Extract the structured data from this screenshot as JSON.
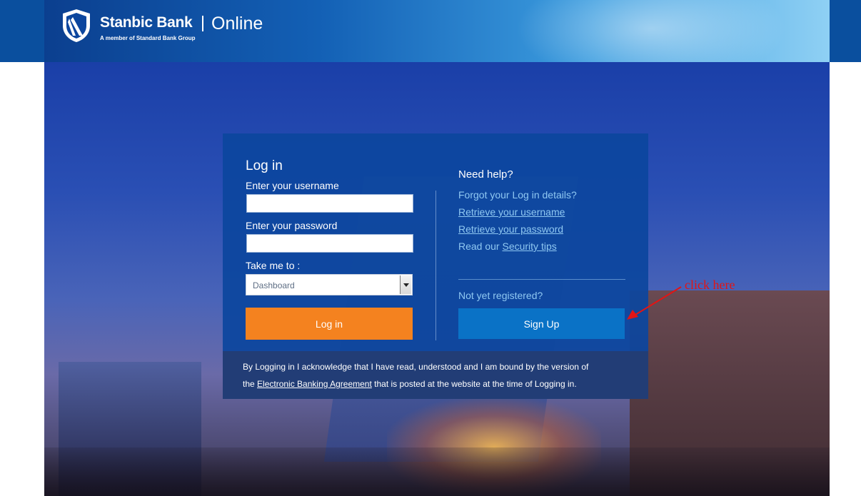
{
  "brand": {
    "name": "Stanbic Bank",
    "tagline": "A member of Standard Bank Group",
    "product": "Online",
    "colors": {
      "primary": "#0c469e",
      "accent": "#f4821f",
      "signup": "#0a72c6",
      "link": "#8fc8f2"
    }
  },
  "login": {
    "title": "Log in",
    "username_label": "Enter your username",
    "username_value": "",
    "password_label": "Enter your password",
    "password_value": "",
    "take_me_label": "Take me to :",
    "take_me_value": "Dashboard",
    "button_label": "Log in"
  },
  "help": {
    "title": "Need help?",
    "forgot_text": "Forgot your Log in details?",
    "retrieve_username": "Retrieve your username",
    "retrieve_password": "Retrieve your password",
    "security_prefix": "Read our",
    "security_link": "Security tips",
    "not_registered": "Not yet registered?",
    "signup_label": "Sign Up"
  },
  "footer": {
    "line1": "By Logging in I acknowledge that I have read, understood and I am bound by the version of",
    "line2_prefix": "the",
    "agreement_link": "Electronic Banking Agreement",
    "line2_suffix": "that is posted at the website at the time of Logging in."
  },
  "annotation": {
    "text": "click here",
    "color": "#e31414"
  },
  "icons": [
    "shield-logo-icon",
    "dropdown-arrow-icon",
    "annotation-arrow-icon"
  ]
}
